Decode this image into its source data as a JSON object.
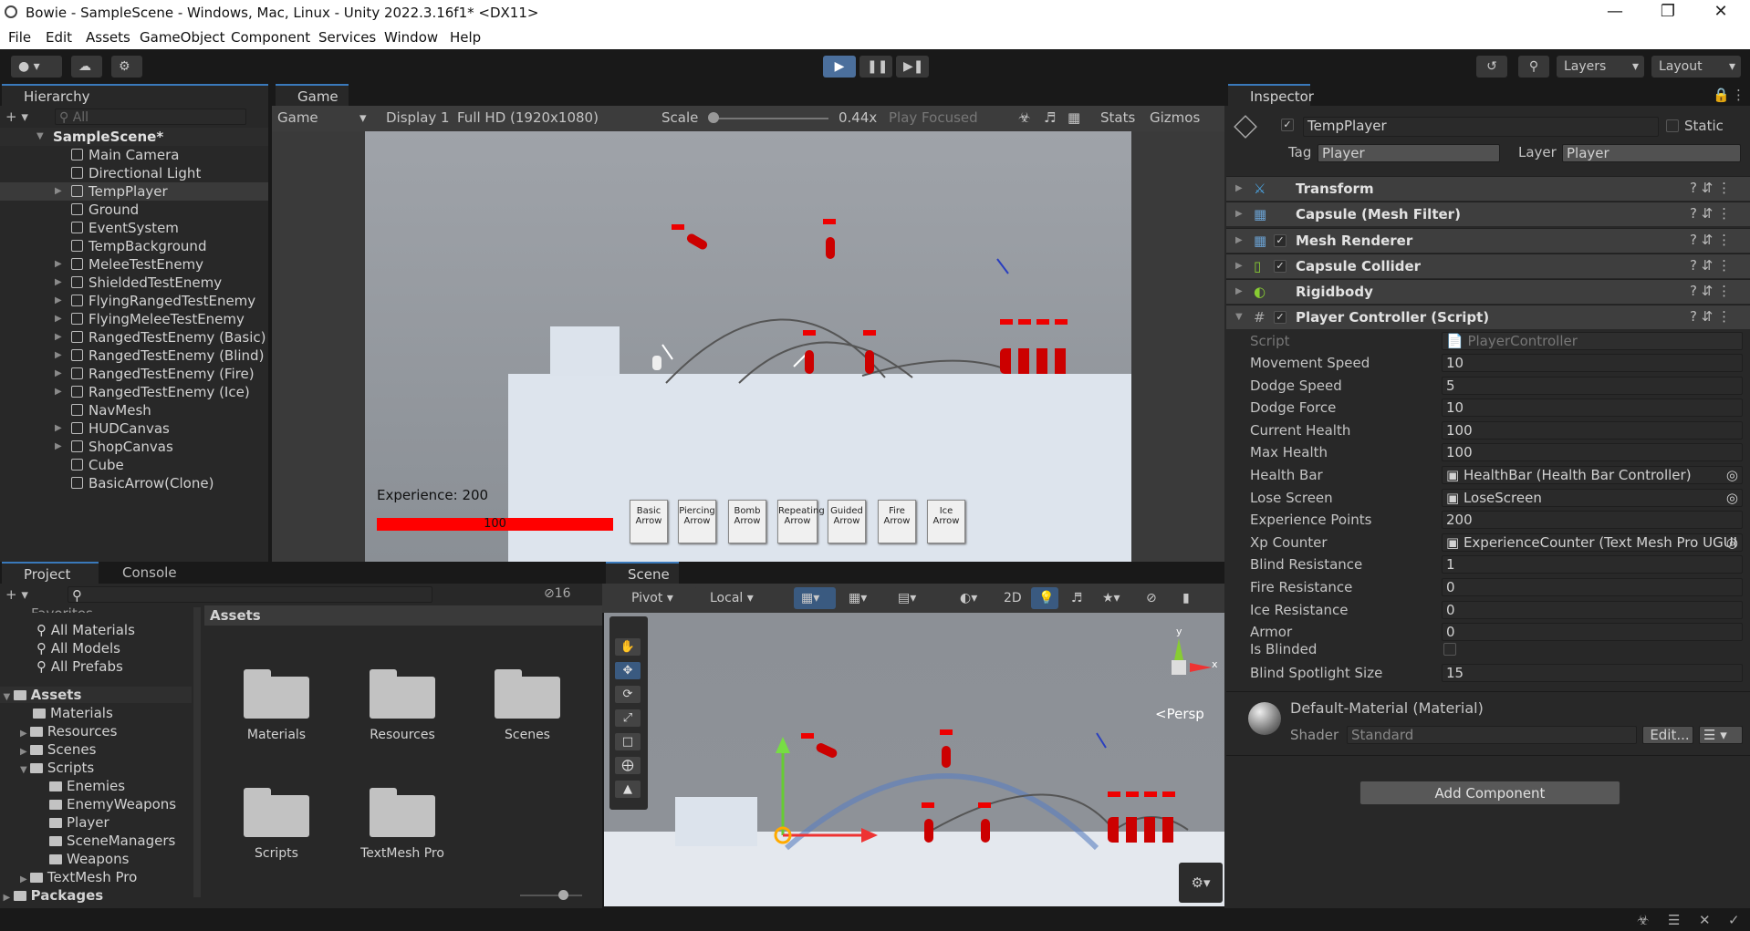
{
  "window": {
    "title": "Bowie - SampleScene - Windows, Mac, Linux - Unity 2022.3.16f1* <DX11>"
  },
  "menu": [
    "File",
    "Edit",
    "Assets",
    "GameObject",
    "Component",
    "Services",
    "Window",
    "Help"
  ],
  "toolbar": {
    "layers": "Layers",
    "layout": "Layout"
  },
  "hierarchy": {
    "tab": "Hierarchy",
    "search_placeholder": "All",
    "scene": "SampleScene*",
    "items": [
      "Main Camera",
      "Directional Light",
      "TempPlayer",
      "Ground",
      "EventSystem",
      "TempBackground",
      "MeleeTestEnemy",
      "ShieldedTestEnemy",
      "FlyingRangedTestEnemy",
      "FlyingMeleeTestEnemy",
      "RangedTestEnemy (Basic)",
      "RangedTestEnemy (Blind)",
      "RangedTestEnemy (Fire)",
      "RangedTestEnemy (Ice)",
      "NavMesh",
      "HUDCanvas",
      "ShopCanvas",
      "Cube",
      "BasicArrow(Clone)"
    ]
  },
  "game": {
    "tab": "Game",
    "mode": "Game",
    "display": "Display 1",
    "resolution": "Full HD (1920x1080)",
    "scale_label": "Scale",
    "scale_value": "0.44x",
    "play_focused": "Play Focused",
    "stats": "Stats",
    "gizmos": "Gizmos",
    "experience": "Experience: 200",
    "health": "100",
    "arrows": [
      "Basic Arrow",
      "Piercing Arrow",
      "Bomb Arrow",
      "Repeating Arrow",
      "Guided Arrow",
      "Fire Arrow",
      "Ice Arrow"
    ]
  },
  "inspector": {
    "tab": "Inspector",
    "object_name": "TempPlayer",
    "static": "Static",
    "tag_label": "Tag",
    "tag": "Player",
    "layer_label": "Layer",
    "layer": "Player",
    "components": [
      "Transform",
      "Capsule (Mesh Filter)",
      "Mesh Renderer",
      "Capsule Collider",
      "Rigidbody",
      "Player Controller (Script)"
    ],
    "script_label": "Script",
    "script_value": "PlayerController",
    "fields": [
      {
        "label": "Movement Speed",
        "value": "10"
      },
      {
        "label": "Dodge Speed",
        "value": "5"
      },
      {
        "label": "Dodge Force",
        "value": "10"
      },
      {
        "label": "Current Health",
        "value": "100"
      },
      {
        "label": "Max Health",
        "value": "100"
      },
      {
        "label": "Health Bar",
        "value": "HealthBar (Health Bar Controller)"
      },
      {
        "label": "Lose Screen",
        "value": "LoseScreen"
      },
      {
        "label": "Experience Points",
        "value": "200"
      },
      {
        "label": "Xp Counter",
        "value": "ExperienceCounter (Text Mesh Pro UGUI"
      },
      {
        "label": "Blind Resistance",
        "value": "1"
      },
      {
        "label": "Fire Resistance",
        "value": "0"
      },
      {
        "label": "Ice Resistance",
        "value": "0"
      },
      {
        "label": "Armor",
        "value": "0"
      }
    ],
    "is_blinded": "Is Blinded",
    "blind_spot_label": "Blind Spotlight Size",
    "blind_spot_value": "15",
    "material": "Default-Material (Material)",
    "shader_label": "Shader",
    "shader": "Standard",
    "edit": "Edit...",
    "add_component": "Add Component"
  },
  "project": {
    "tab": "Project",
    "console_tab": "Console",
    "hidden_count": "16",
    "favorites": "Favorites",
    "fav_items": [
      "All Materials",
      "All Models",
      "All Prefabs"
    ],
    "assets": "Assets",
    "tree": [
      {
        "label": "Materials",
        "indent": 1
      },
      {
        "label": "Resources",
        "indent": 1
      },
      {
        "label": "Scenes",
        "indent": 1
      },
      {
        "label": "Scripts",
        "indent": 1
      },
      {
        "label": "Enemies",
        "indent": 2
      },
      {
        "label": "EnemyWeapons",
        "indent": 2
      },
      {
        "label": "Player",
        "indent": 2
      },
      {
        "label": "SceneManagers",
        "indent": 2
      },
      {
        "label": "Weapons",
        "indent": 2
      },
      {
        "label": "TextMesh Pro",
        "indent": 1
      }
    ],
    "packages": "Packages",
    "header": "Assets",
    "folders": [
      "Materials",
      "Resources",
      "Scenes",
      "Scripts",
      "TextMesh Pro"
    ]
  },
  "scene": {
    "tab": "Scene",
    "pivot": "Pivot",
    "local": "Local",
    "mode2d": "2D",
    "persp": "Persp"
  }
}
